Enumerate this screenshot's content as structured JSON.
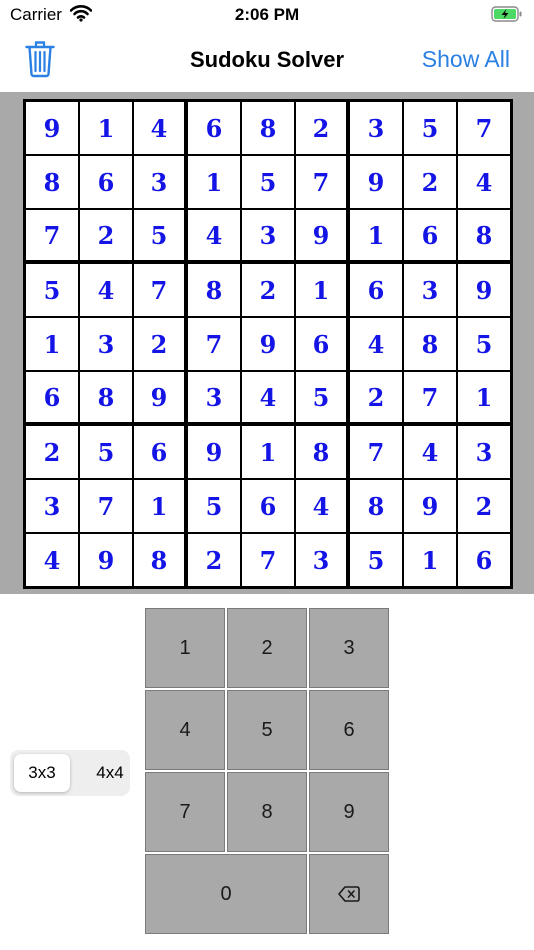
{
  "status": {
    "carrier": "Carrier",
    "time": "2:06 PM"
  },
  "nav": {
    "title": "Sudoku Solver",
    "action": "Show All"
  },
  "board": {
    "rows": [
      [
        9,
        1,
        4,
        6,
        8,
        2,
        3,
        5,
        7
      ],
      [
        8,
        6,
        3,
        1,
        5,
        7,
        9,
        2,
        4
      ],
      [
        7,
        2,
        5,
        4,
        3,
        9,
        1,
        6,
        8
      ],
      [
        5,
        4,
        7,
        8,
        2,
        1,
        6,
        3,
        9
      ],
      [
        1,
        3,
        2,
        7,
        9,
        6,
        4,
        8,
        5
      ],
      [
        6,
        8,
        9,
        3,
        4,
        5,
        2,
        7,
        1
      ],
      [
        2,
        5,
        6,
        9,
        1,
        8,
        7,
        4,
        3
      ],
      [
        3,
        7,
        1,
        5,
        6,
        4,
        8,
        9,
        2
      ],
      [
        4,
        9,
        8,
        2,
        7,
        3,
        5,
        1,
        6
      ]
    ]
  },
  "size_toggle": {
    "options": [
      "3x3",
      "4x4"
    ],
    "selected": "3x3"
  },
  "keypad": {
    "keys": [
      "1",
      "2",
      "3",
      "4",
      "5",
      "6",
      "7",
      "8",
      "9",
      "0"
    ],
    "delete_icon": "delete-left-icon"
  },
  "colors": {
    "digit": "#1414e6",
    "accent": "#2b80e4",
    "board_background": "#a9a9a9",
    "key_background": "#a9a9a9",
    "battery": "#4cd964"
  }
}
